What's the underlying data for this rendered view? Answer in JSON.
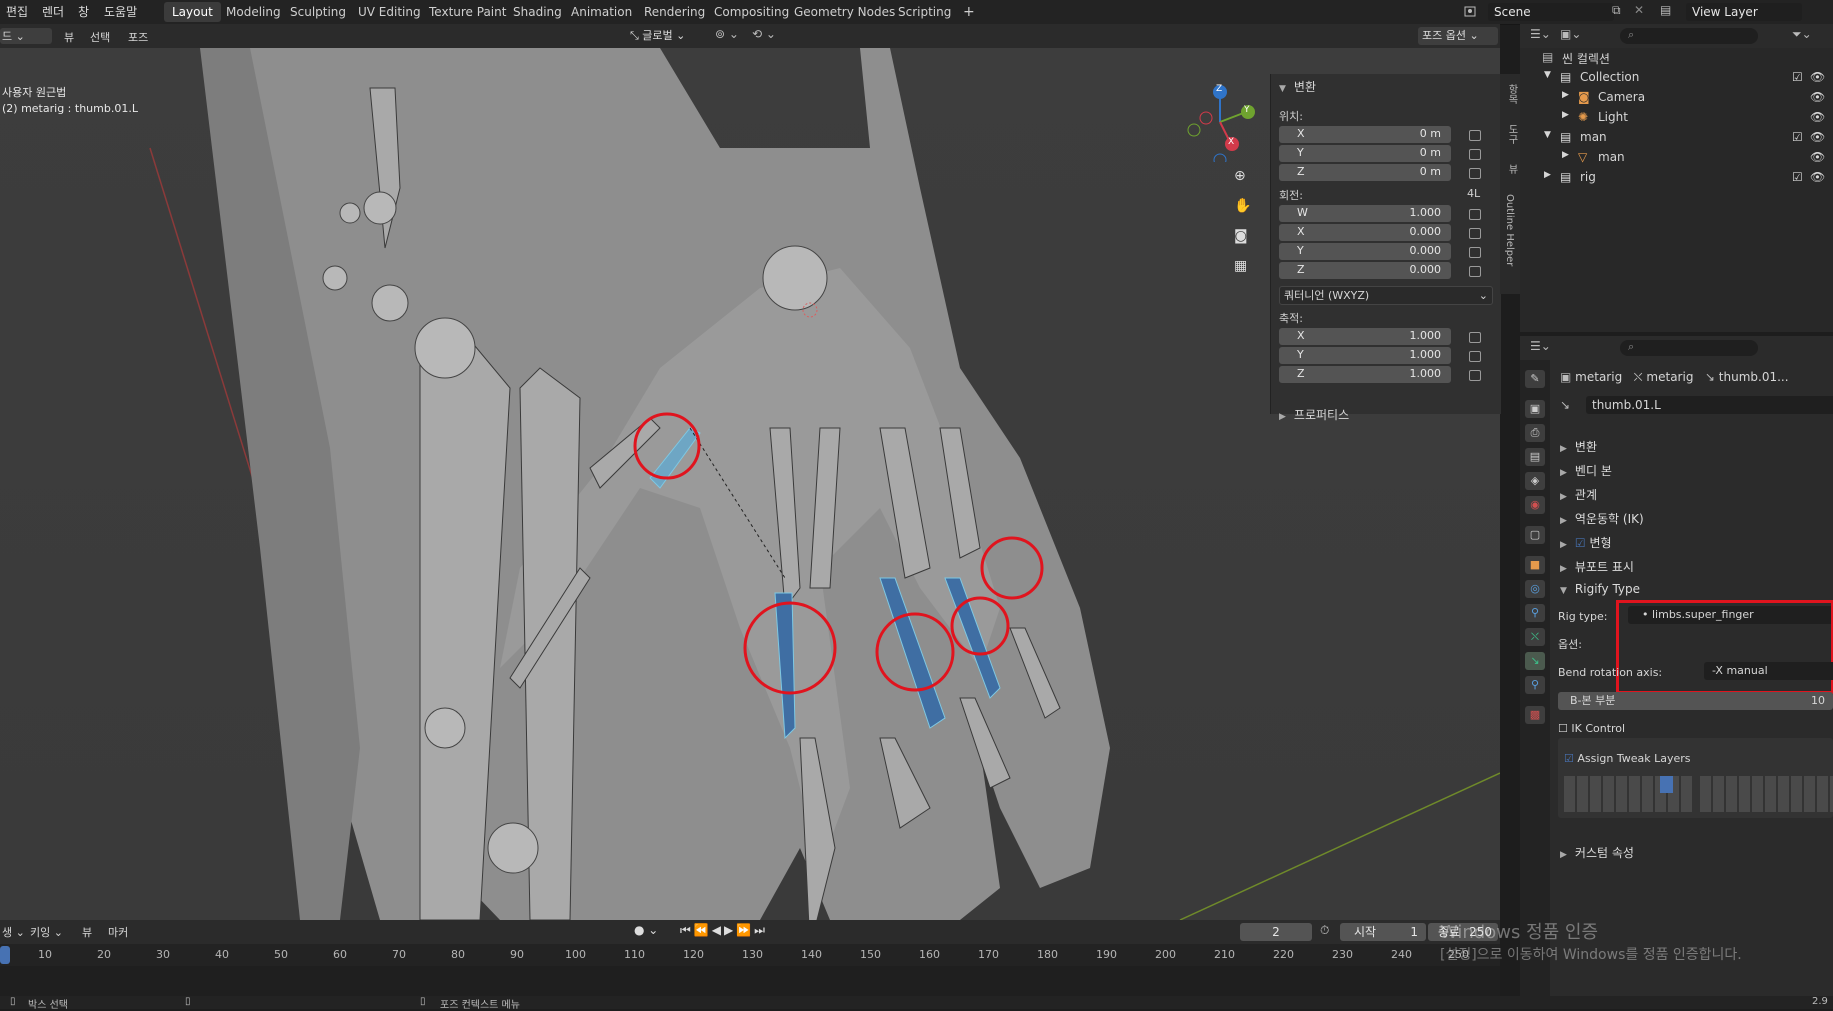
{
  "menus": [
    "편집",
    "렌더",
    "창",
    "도움말"
  ],
  "workspaces": [
    "Layout",
    "Modeling",
    "Sculpting",
    "UV Editing",
    "Texture Paint",
    "Shading",
    "Animation",
    "Rendering",
    "Compositing",
    "Geometry Nodes",
    "Scripting"
  ],
  "scene": "Scene",
  "view_layer": "View Layer",
  "viewport": {
    "mode_label": "드",
    "menu": [
      "뷰",
      "선택",
      "포즈"
    ],
    "orientation": "글로벌",
    "pose_options": "포즈 옵션",
    "overlay_line1": "사용자 원근법",
    "overlay_line2": "(2) metarig : thumb.01.L",
    "axes": {
      "x": "X",
      "y": "Y",
      "z": "Z"
    }
  },
  "npanel": {
    "header": "변환",
    "location_label": "위치:",
    "location": [
      {
        "axis": "X",
        "value": "0 m"
      },
      {
        "axis": "Y",
        "value": "0 m"
      },
      {
        "axis": "Z",
        "value": "0 m"
      }
    ],
    "rotation_label": "회전:",
    "rotation_mode_tag": "4L",
    "rotation": [
      {
        "axis": "W",
        "value": "1.000"
      },
      {
        "axis": "X",
        "value": "0.000"
      },
      {
        "axis": "Y",
        "value": "0.000"
      },
      {
        "axis": "Z",
        "value": "0.000"
      }
    ],
    "rotation_mode": "쿼터니언 (WXYZ)",
    "scale_label": "축적:",
    "scale": [
      {
        "axis": "X",
        "value": "1.000"
      },
      {
        "axis": "Y",
        "value": "1.000"
      },
      {
        "axis": "Z",
        "value": "1.000"
      }
    ],
    "properties": "프로퍼티스",
    "sidetabs": [
      "항목",
      "도구",
      "뷰",
      "Outline Helper"
    ]
  },
  "outliner": {
    "title": "씬 컬렉션",
    "rows": [
      {
        "label": "Collection",
        "indent": 1
      },
      {
        "label": "Camera",
        "indent": 2
      },
      {
        "label": "Light",
        "indent": 2
      },
      {
        "label": "man",
        "indent": 1
      },
      {
        "label": "man",
        "indent": 2
      },
      {
        "label": "rig",
        "indent": 1
      }
    ]
  },
  "props": {
    "breadcrumb": [
      "metarig",
      "metarig",
      "thumb.01..."
    ],
    "bone_name": "thumb.01.L",
    "sections": [
      "변환",
      "벤디 본",
      "관계",
      "역운동학 (IK)",
      "변형",
      "뷰포트 표시",
      "Rigify Type"
    ],
    "rig_type_label": "Rig type:",
    "rig_type_value": "limbs.super_finger",
    "options_label": "옵션:",
    "bend_label": "Bend rotation axis:",
    "bend_value": "-X manual",
    "bbone_label": "B-본 부분",
    "bbone_value": "10",
    "ik_control": "IK Control",
    "assign_tweak": "Assign Tweak Layers",
    "custom_props": "커스텀 속성"
  },
  "timeline": {
    "menu": [
      "생",
      "키잉",
      "뷰",
      "마커"
    ],
    "current_frame": "2",
    "start_label": "시작",
    "start": "1",
    "end_label": "종료",
    "end": "250",
    "ticks": [
      "10",
      "20",
      "30",
      "40",
      "50",
      "60",
      "70",
      "80",
      "90",
      "100",
      "110",
      "120",
      "130",
      "140",
      "150",
      "160",
      "170",
      "180",
      "190",
      "200",
      "210",
      "220",
      "230",
      "240",
      "250"
    ]
  },
  "status": {
    "left": "박스 선택",
    "mid": "포즈 컨텍스트 메뉴",
    "version": "2.9"
  },
  "watermark": {
    "line1": "Windows 정품 인증",
    "line2": "[설정]으로 이동하여 Windows를 정품 인증합니다."
  },
  "colors": {
    "accent": "#4772b3",
    "annotation": "#e0141e",
    "bone_selected": "#7ec8e3"
  }
}
